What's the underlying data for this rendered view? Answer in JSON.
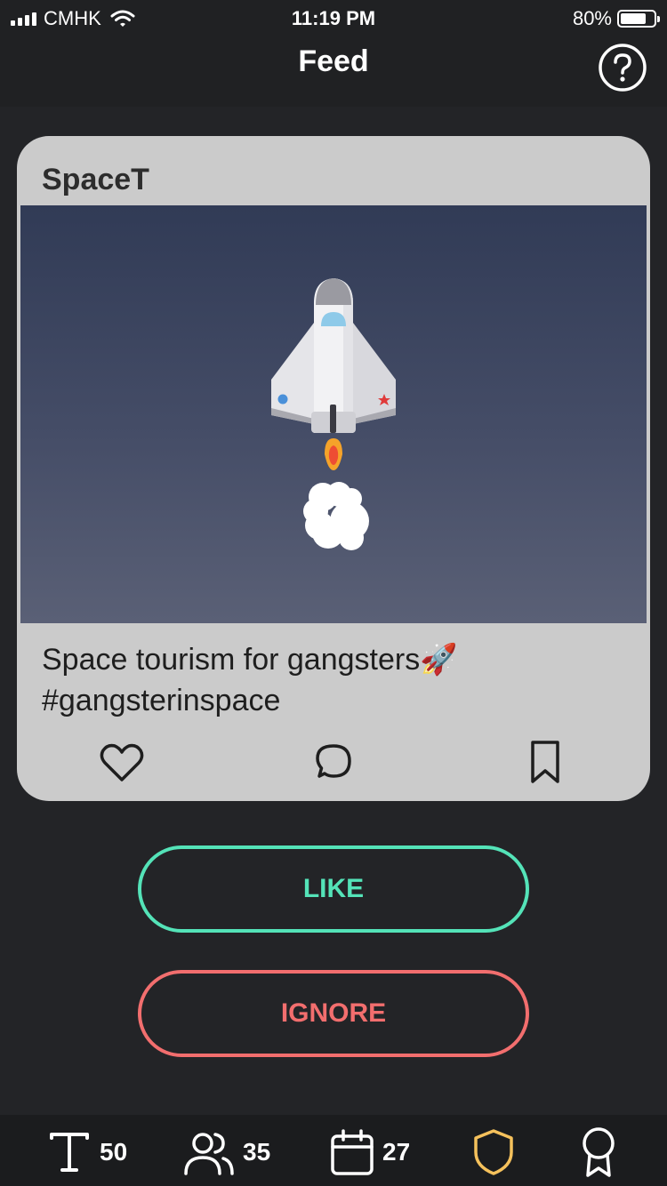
{
  "status": {
    "carrier": "CMHK",
    "time": "11:19 PM",
    "battery": "80%",
    "battery_level": 0.8
  },
  "nav": {
    "title": "Feed",
    "help_icon": "question-circle-icon"
  },
  "post": {
    "author": "SpaceT",
    "image": "rocket-launch-illustration",
    "caption": "Space tourism for gangsters🚀 #gangsterinspace",
    "actions": [
      "heart-icon",
      "comment-icon",
      "bookmark-icon"
    ]
  },
  "buttons": {
    "like_label": "LIKE",
    "ignore_label": "IGNORE"
  },
  "tabs": [
    {
      "icon": "text-icon",
      "count": "50"
    },
    {
      "icon": "users-icon",
      "count": "35"
    },
    {
      "icon": "calendar-icon",
      "count": "27"
    },
    {
      "icon": "shield-icon",
      "count": ""
    },
    {
      "icon": "award-icon",
      "count": ""
    }
  ],
  "colors": {
    "background": "#232427",
    "like": "#54e3b8",
    "ignore": "#f26e6e",
    "shield_active": "#f5c15c",
    "card": "#cbcbcb"
  }
}
